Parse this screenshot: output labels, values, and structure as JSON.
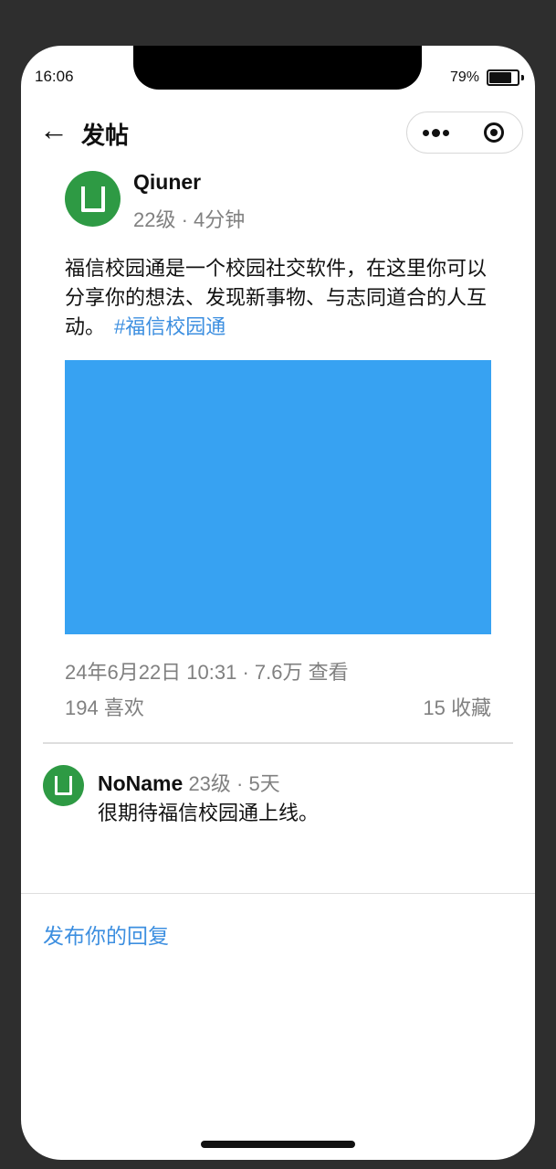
{
  "status_bar": {
    "time": "16:06",
    "battery": "79%",
    "battery_level": 0.79
  },
  "header": {
    "back_arrow": "←",
    "title": "发帖",
    "more_icon": "more-dots-icon",
    "close_icon": "target-circle-icon"
  },
  "post": {
    "author": "Qiuner",
    "meta": "22级 · 4分钟",
    "content": "福信校园通是一个校园社交软件，在这里你可以分享你的想法、发现新事物、与志同道合的人互动。",
    "hashtag": "#福信校园通",
    "image_color": "#37a2f2",
    "stats": "24年6月22日 10:31 · 7.6万 查看",
    "likes": "194 喜欢",
    "favorites": "15 收藏"
  },
  "comments": [
    {
      "user": "NoName",
      "meta": "23级 · 5天",
      "text": "很期待福信校园通上线。"
    }
  ],
  "reply": {
    "label": "发布你的回复"
  },
  "colors": {
    "accent": "#3d8fe0",
    "avatar": "#2e9a44",
    "muted_text": "#808080"
  }
}
